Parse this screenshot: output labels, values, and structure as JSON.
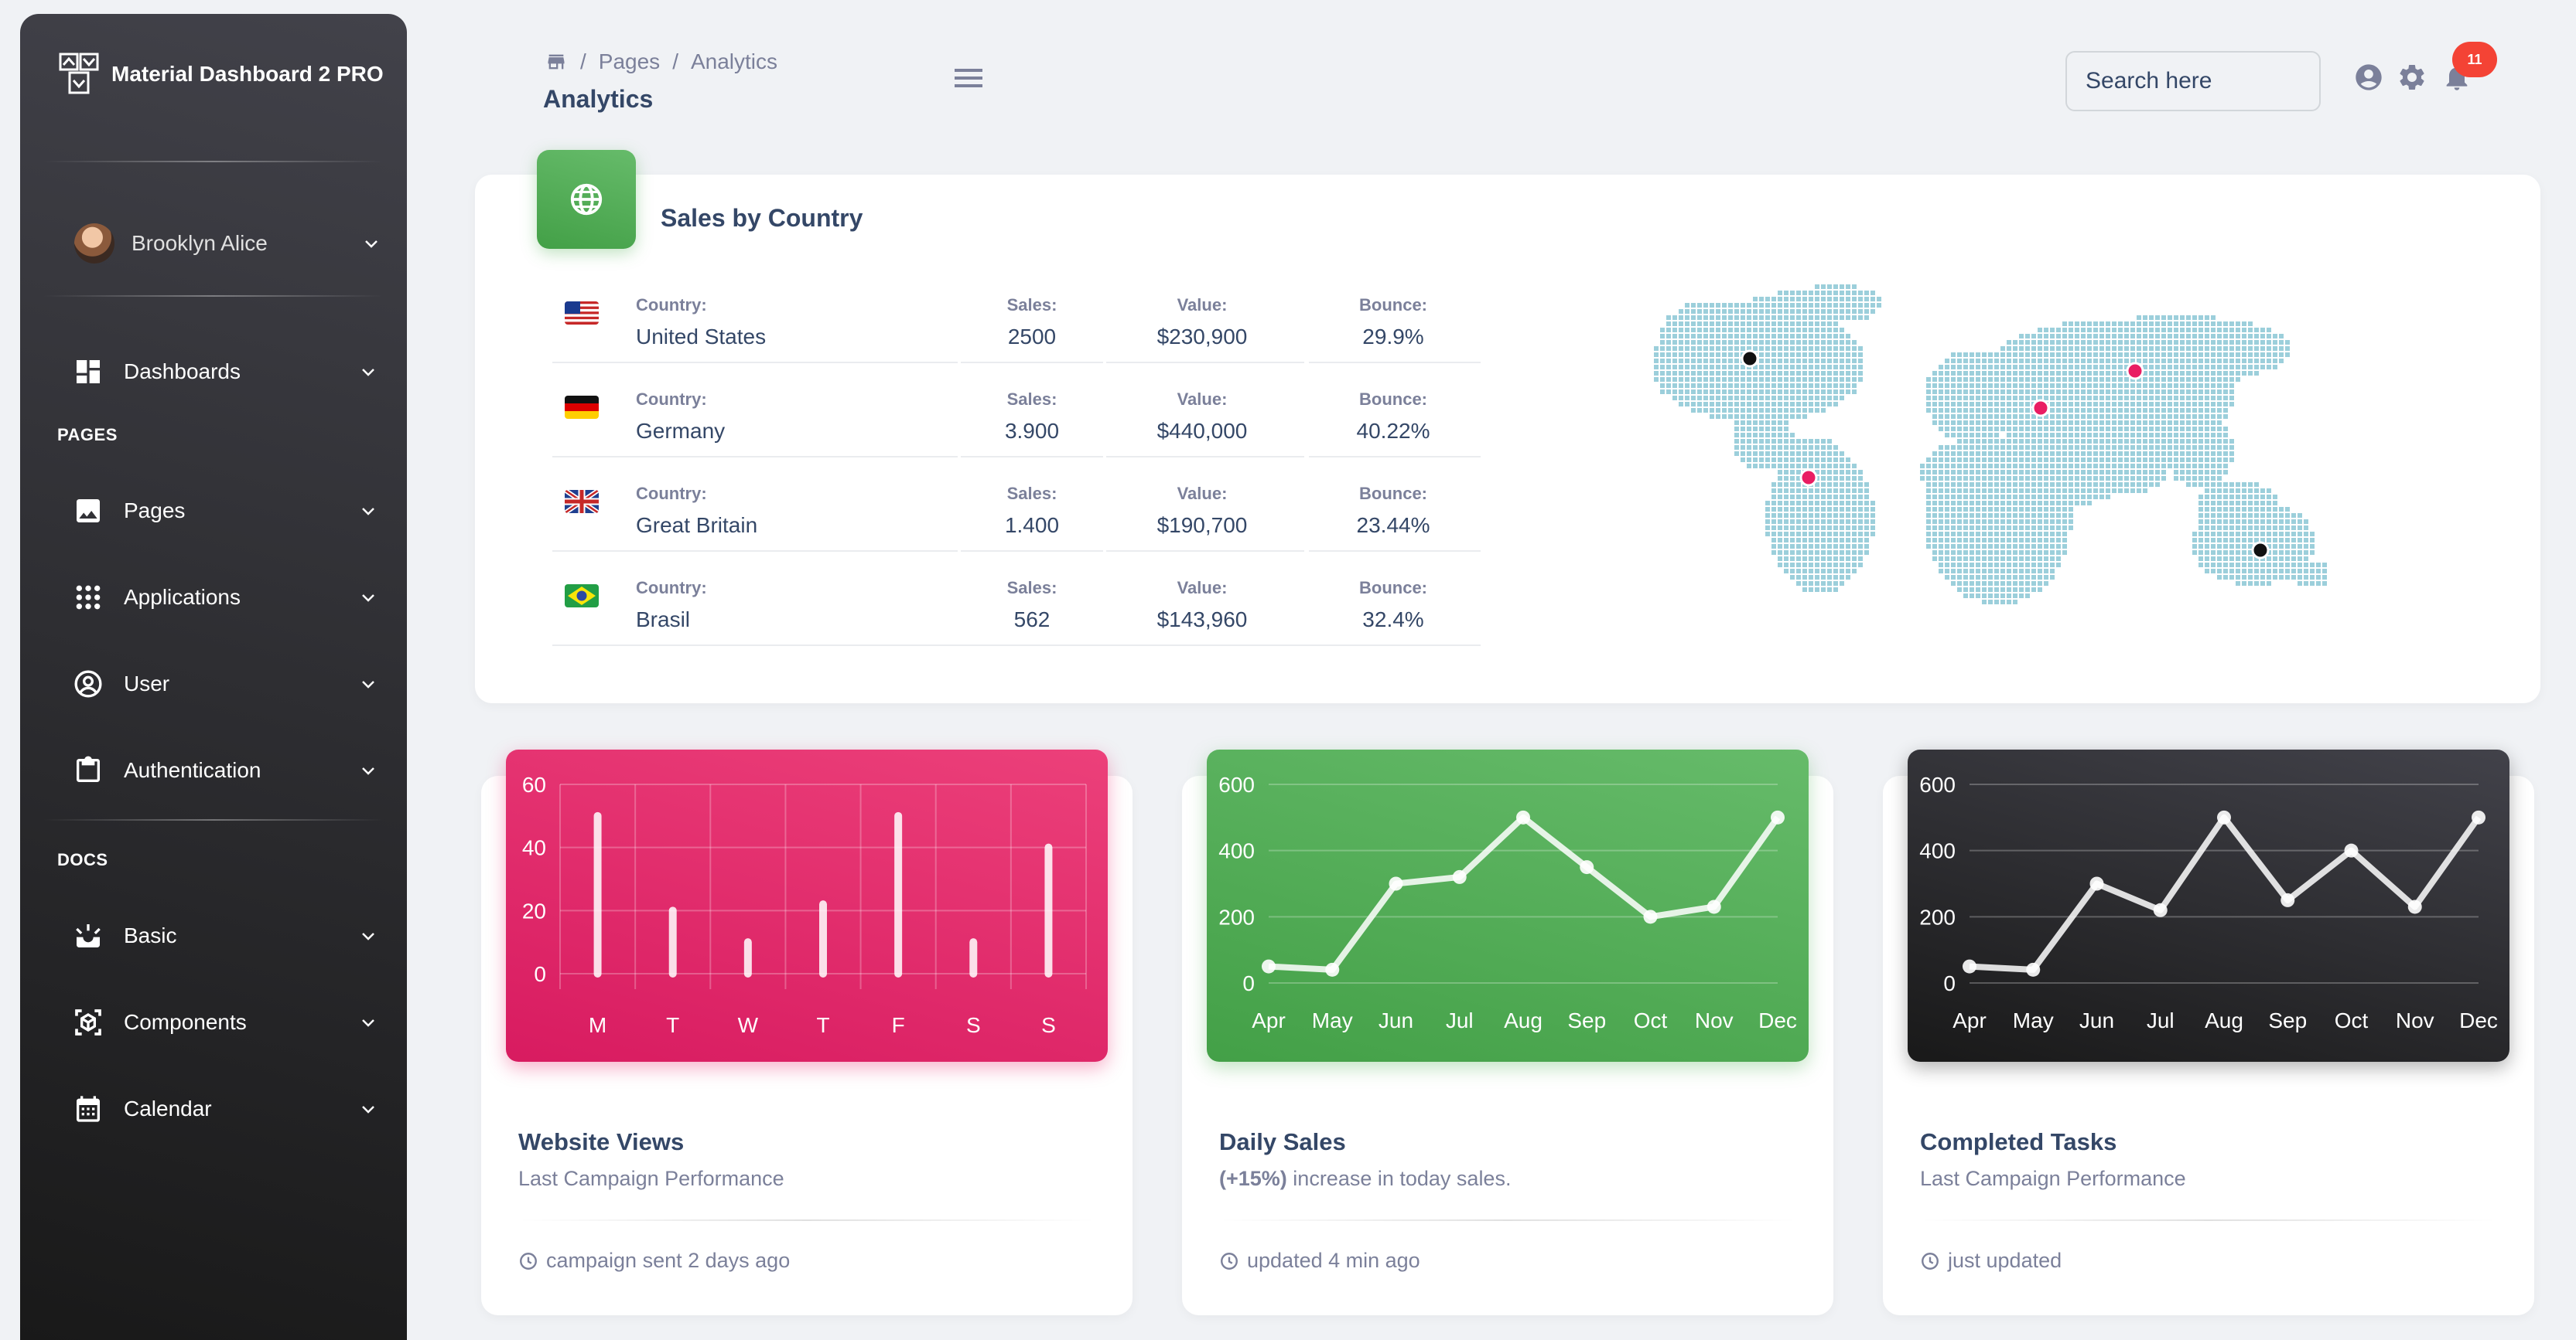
{
  "sidebar": {
    "brand": "Material Dashboard 2 PRO",
    "user_name": "Brooklyn Alice",
    "items": [
      {
        "label": "Dashboards",
        "icon": "dashboard-icon"
      },
      {
        "label": "Pages",
        "icon": "image-icon"
      },
      {
        "label": "Applications",
        "icon": "apps-icon"
      },
      {
        "label": "User",
        "icon": "account-circle-icon"
      },
      {
        "label": "Authentication",
        "icon": "clipboard-icon"
      },
      {
        "label": "Basic",
        "icon": "upcoming-icon"
      },
      {
        "label": "Components",
        "icon": "view-in-ar-icon"
      },
      {
        "label": "Calendar",
        "icon": "calendar-icon"
      }
    ],
    "sections": {
      "pages": "PAGES",
      "docs": "DOCS"
    }
  },
  "header": {
    "breadcrumb": [
      "Pages",
      "Analytics"
    ],
    "title": "Analytics",
    "search_placeholder": "Search here",
    "notification_count": "11"
  },
  "sales_by_country": {
    "title": "Sales by Country",
    "labels": {
      "country": "Country:",
      "sales": "Sales:",
      "value": "Value:",
      "bounce": "Bounce:"
    },
    "rows": [
      {
        "flag": "us",
        "country": "United States",
        "sales": "2500",
        "value": "$230,900",
        "bounce": "29.9%"
      },
      {
        "flag": "de",
        "country": "Germany",
        "sales": "3.900",
        "value": "$440,000",
        "bounce": "40.22%"
      },
      {
        "flag": "gb",
        "country": "Great Britain",
        "sales": "1.400",
        "value": "$190,700",
        "bounce": "23.44%"
      },
      {
        "flag": "br",
        "country": "Brasil",
        "sales": "562",
        "value": "$143,960",
        "bounce": "32.4%"
      }
    ]
  },
  "cards": [
    {
      "title": "Website Views",
      "subtitle": "Last Campaign Performance",
      "footer": "campaign sent 2 days ago",
      "color": "#d81b60"
    },
    {
      "title": "Daily Sales",
      "subtitle_bold": "(+15%)",
      "subtitle": " increase in today sales.",
      "footer": "updated 4 min ago",
      "color": "#4caf50"
    },
    {
      "title": "Completed Tasks",
      "subtitle": "Last Campaign Performance",
      "footer": "just updated",
      "color": "#191919"
    }
  ],
  "chart_data": [
    {
      "type": "bar",
      "categories": [
        "M",
        "T",
        "W",
        "T",
        "F",
        "S",
        "S"
      ],
      "values": [
        50,
        20,
        10,
        22,
        50,
        10,
        40
      ],
      "ylim": [
        0,
        60
      ],
      "yticks": [
        0,
        20,
        40,
        60
      ],
      "grid": true
    },
    {
      "type": "line",
      "categories": [
        "Apr",
        "May",
        "Jun",
        "Jul",
        "Aug",
        "Sep",
        "Oct",
        "Nov",
        "Dec"
      ],
      "values": [
        50,
        40,
        300,
        320,
        500,
        350,
        200,
        230,
        500
      ],
      "ylim": [
        0,
        600
      ],
      "yticks": [
        0,
        200,
        400,
        600
      ],
      "grid": true
    },
    {
      "type": "line",
      "categories": [
        "Apr",
        "May",
        "Jun",
        "Jul",
        "Aug",
        "Sep",
        "Oct",
        "Nov",
        "Dec"
      ],
      "values": [
        50,
        40,
        300,
        220,
        500,
        250,
        400,
        230,
        500
      ],
      "ylim": [
        0,
        600
      ],
      "yticks": [
        0,
        200,
        400,
        600
      ],
      "grid": true
    }
  ]
}
